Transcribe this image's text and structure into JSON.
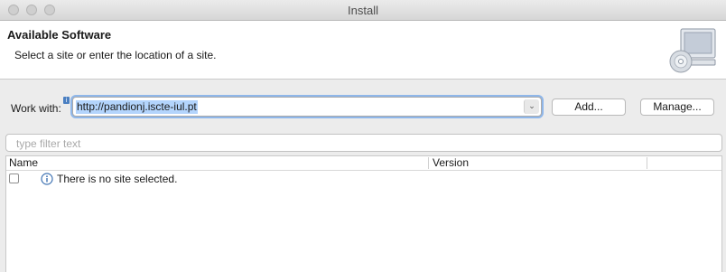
{
  "window": {
    "title": "Install"
  },
  "header": {
    "title": "Available Software",
    "description": "Select a site or enter the location of a site."
  },
  "work_with": {
    "label": "Work with:",
    "value": "http://pandionj.iscte-iul.pt",
    "add_label": "Add...",
    "manage_label": "Manage..."
  },
  "filter": {
    "placeholder": "type filter text"
  },
  "table": {
    "columns": [
      "Name",
      "Version"
    ],
    "rows": [
      {
        "checked": false,
        "icon": "info-icon",
        "text": "There is no site selected."
      }
    ]
  }
}
